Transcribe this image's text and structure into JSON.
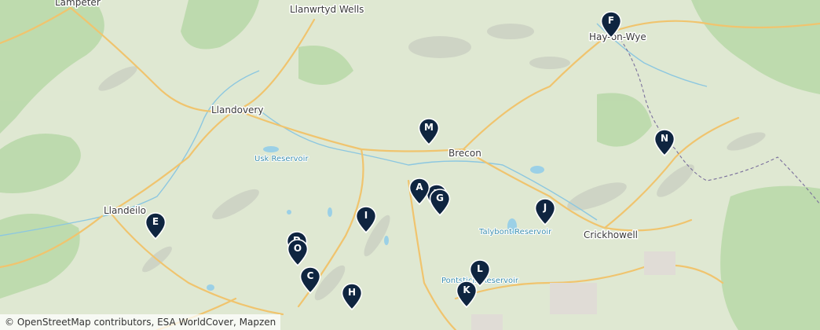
{
  "places": {
    "lampeter": "Lampeter",
    "llanwrtyd_wells": "Llanwrtyd Wells",
    "hay_on_wye": "Hay-on-Wye",
    "llandovery": "Llandovery",
    "brecon": "Brecon",
    "llandeilo": "Llandeilo",
    "crickhowell": "Crickhowell",
    "usk_reservoir": "Usk Reservoir",
    "talybont_reservoir": "Talybont Reservoir",
    "pontsticill_reservoir": "Pontsticill Reservoir"
  },
  "markers": [
    "A",
    "B",
    "C",
    "D",
    "E",
    "F",
    "G",
    "H",
    "I",
    "J",
    "K",
    "L",
    "M",
    "N",
    "O"
  ],
  "attribution": "© OpenStreetMap contributors, ESA WorldCover, Mapzen",
  "colors": {
    "land": "#dfe8d2",
    "forest": "#a9cf9a",
    "rock": "#c9cfc2",
    "road": "#f2c36b",
    "water": "#9bd0e6",
    "border": "#7a6f9c",
    "marker": "#0f2540"
  }
}
